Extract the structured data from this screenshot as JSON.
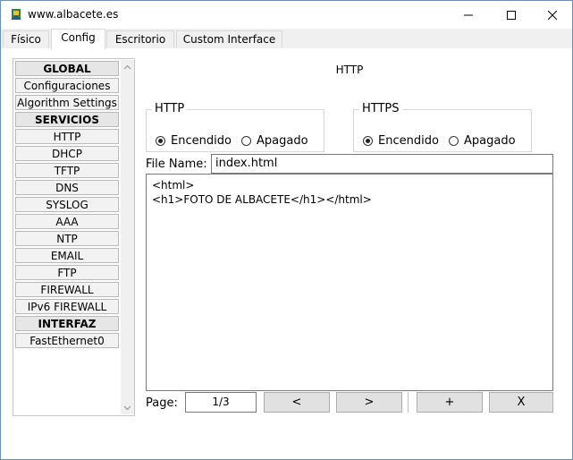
{
  "window": {
    "title": "www.albacete.es"
  },
  "tabs": [
    {
      "label": "Físico"
    },
    {
      "label": "Config"
    },
    {
      "label": "Escritorio"
    },
    {
      "label": "Custom Interface"
    }
  ],
  "sidebar": {
    "items": [
      {
        "label": "GLOBAL"
      },
      {
        "label": "Configuraciones"
      },
      {
        "label": "Algorithm Settings"
      },
      {
        "label": "SERVICIOS"
      },
      {
        "label": "HTTP"
      },
      {
        "label": "DHCP"
      },
      {
        "label": "TFTP"
      },
      {
        "label": "DNS"
      },
      {
        "label": "SYSLOG"
      },
      {
        "label": "AAA"
      },
      {
        "label": "NTP"
      },
      {
        "label": "EMAIL"
      },
      {
        "label": "FTP"
      },
      {
        "label": "FIREWALL"
      },
      {
        "label": "IPv6 FIREWALL"
      },
      {
        "label": "INTERFAZ"
      },
      {
        "label": "FastEthernet0"
      }
    ]
  },
  "main": {
    "title": "HTTP",
    "http": {
      "label": "HTTP",
      "on": "Encendido",
      "off": "Apagado"
    },
    "https": {
      "label": "HTTPS",
      "on": "Encendido",
      "off": "Apagado"
    },
    "file_name_label": "File Name:",
    "file_name_value": "index.html",
    "editor_content": "<html>\n<h1>FOTO DE ALBACETE</h1></html>",
    "page_label": "Page:",
    "page_value": "1/3",
    "buttons": {
      "prev": "<",
      "next": ">",
      "add": "+",
      "remove": "X"
    }
  }
}
